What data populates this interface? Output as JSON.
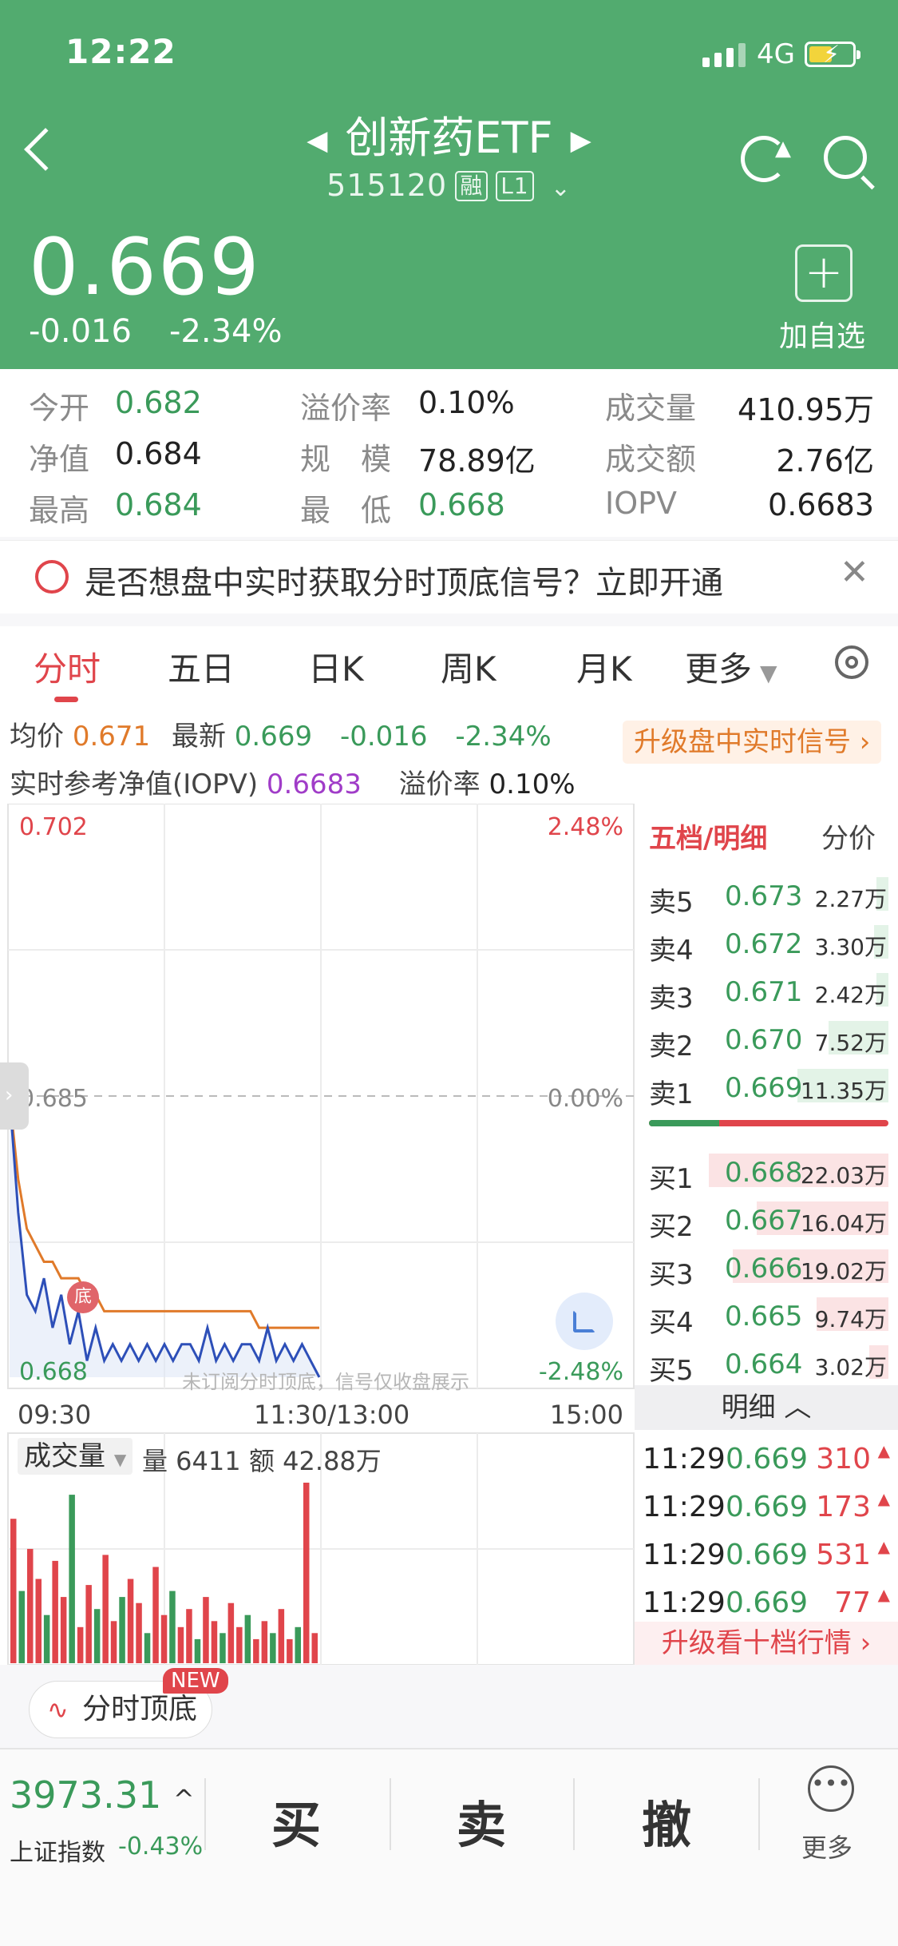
{
  "status": {
    "time": "12:22",
    "network": "4G"
  },
  "header": {
    "title": "创新药ETF",
    "code": "515120",
    "tag_margin": "融",
    "tag_level": "L1",
    "price": "0.669",
    "change": "-0.016",
    "change_pct": "-2.34%",
    "add_label": "加自选"
  },
  "stats": {
    "open_label": "今开",
    "open": "0.682",
    "premium_label": "溢价率",
    "premium": "0.10%",
    "volume_label": "成交量",
    "volume": "410.95万",
    "nav_label": "净值",
    "nav": "0.684",
    "scale_label": "规　模",
    "scale": "78.89亿",
    "amount_label": "成交额",
    "amount": "2.76亿",
    "high_label": "最高",
    "high": "0.684",
    "low_label": "最　低",
    "low": "0.668",
    "iopv_label": "IOPV",
    "iopv": "0.6683"
  },
  "promo": {
    "text": "是否想盘中实时获取分时顶底信号？立即开通"
  },
  "tabs": [
    "分时",
    "五日",
    "日K",
    "周K",
    "月K",
    "更多"
  ],
  "info": {
    "avg_label": "均价",
    "avg": "0.671",
    "latest_label": "最新",
    "latest": "0.669",
    "chg": "-0.016",
    "chg_pct": "-2.34%",
    "iopv_label": "实时参考净值(IOPV)",
    "iopv": "0.6683",
    "premium_label": "溢价率",
    "premium": "0.10%",
    "upgrade": "升级盘中实时信号"
  },
  "chart_labels": {
    "top_price": "0.702",
    "top_pct": "2.48%",
    "mid_price": "0.685",
    "mid_pct": "0.00%",
    "bot_price": "0.668",
    "bot_pct": "-2.48%",
    "t_start": "09:30",
    "t_mid": "11:30/13:00",
    "t_end": "15:00",
    "marker": "底",
    "watermark": "未订阅分时顶底，信号仅收盘展示",
    "vol_label": "成交量",
    "vol_q": "量 6411",
    "vol_amt": "额 42.88万"
  },
  "chart_data": {
    "type": "line",
    "ylim": [
      0.668,
      0.702
    ],
    "series": [
      {
        "name": "最新",
        "color": "#2d4fb8",
        "values": [
          0.685,
          0.678,
          0.673,
          0.672,
          0.674,
          0.671,
          0.673,
          0.67,
          0.672,
          0.669,
          0.671,
          0.669,
          0.67,
          0.669,
          0.67,
          0.669,
          0.67,
          0.669,
          0.67,
          0.669,
          0.67,
          0.67,
          0.669,
          0.671,
          0.669,
          0.67,
          0.669,
          0.67,
          0.67,
          0.669,
          0.671,
          0.669,
          0.67,
          0.669,
          0.67,
          0.669,
          0.668
        ]
      },
      {
        "name": "均价",
        "color": "#e07a2a",
        "values": [
          0.685,
          0.68,
          0.677,
          0.676,
          0.675,
          0.675,
          0.674,
          0.674,
          0.674,
          0.673,
          0.673,
          0.672,
          0.672,
          0.672,
          0.672,
          0.672,
          0.672,
          0.672,
          0.672,
          0.672,
          0.672,
          0.672,
          0.672,
          0.672,
          0.672,
          0.672,
          0.672,
          0.672,
          0.672,
          0.671,
          0.671,
          0.671,
          0.671,
          0.671,
          0.671,
          0.671,
          0.671
        ]
      }
    ],
    "volume": [
      120,
      60,
      95,
      70,
      40,
      85,
      55,
      140,
      30,
      65,
      45,
      90,
      35,
      55,
      70,
      50,
      25,
      80,
      40,
      60,
      30,
      45,
      20,
      55,
      35,
      25,
      50,
      30,
      40,
      20,
      35,
      25,
      45,
      20,
      30,
      150,
      25
    ]
  },
  "orderbook": {
    "title": "五档/明细",
    "alt": "分价",
    "asks": [
      {
        "label": "卖5",
        "price": "0.673",
        "vol": "2.27万",
        "frac": 0.05
      },
      {
        "label": "卖4",
        "price": "0.672",
        "vol": "3.30万",
        "frac": 0.06
      },
      {
        "label": "卖3",
        "price": "0.671",
        "vol": "2.42万",
        "frac": 0.05
      },
      {
        "label": "卖2",
        "price": "0.670",
        "vol": "7.52万",
        "frac": 0.25
      },
      {
        "label": "卖1",
        "price": "0.669",
        "vol": "11.35万",
        "frac": 0.38
      }
    ],
    "bids": [
      {
        "label": "买1",
        "price": "0.668",
        "vol": "22.03万",
        "frac": 0.75
      },
      {
        "label": "买2",
        "price": "0.667",
        "vol": "16.04万",
        "frac": 0.55
      },
      {
        "label": "买3",
        "price": "0.666",
        "vol": "19.02万",
        "frac": 0.65
      },
      {
        "label": "买4",
        "price": "0.665",
        "vol": "9.74万",
        "frac": 0.3
      },
      {
        "label": "买5",
        "price": "0.664",
        "vol": "3.02万",
        "frac": 0.08
      }
    ],
    "detail_header": "明细",
    "details": [
      {
        "time": "11:29",
        "price": "0.669",
        "vol": "310"
      },
      {
        "time": "11:29",
        "price": "0.669",
        "vol": "173"
      },
      {
        "time": "11:29",
        "price": "0.669",
        "vol": "531"
      },
      {
        "time": "11:29",
        "price": "0.669",
        "vol": "77"
      }
    ],
    "upgrade": "升级看十档行情"
  },
  "pill": {
    "label": "分时顶底",
    "new": "NEW"
  },
  "bottom": {
    "index_value": "3973.31",
    "index_name": "上证指数",
    "index_chg": "-0.43%",
    "buy": "买",
    "sell": "卖",
    "cancel": "撤",
    "more": "更多"
  }
}
